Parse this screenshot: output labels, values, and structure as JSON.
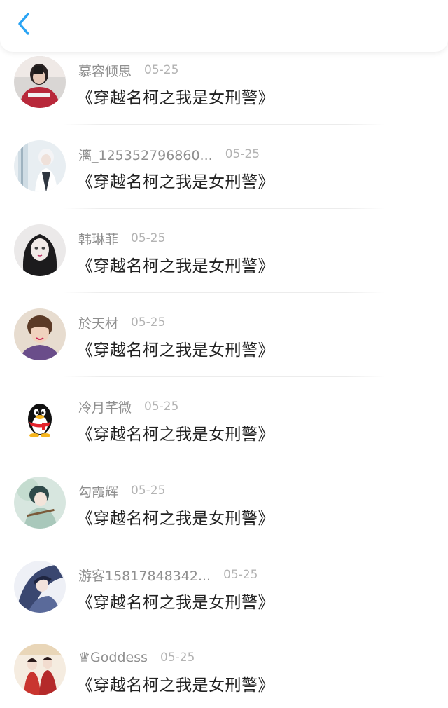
{
  "header": {
    "back_icon": "chevron-left-icon",
    "accent_color": "#2aa4f4"
  },
  "items": [
    {
      "username": "慕容倾思",
      "date": "05-25",
      "title": "《穿越名柯之我是女刑警》",
      "avatar": "girl-selfie-avatar"
    },
    {
      "username": "漓_125352796860...",
      "date": "05-25",
      "title": "《穿越名柯之我是女刑警》",
      "avatar": "anime-boy-avatar"
    },
    {
      "username": "韩琳菲",
      "date": "05-25",
      "title": "《穿越名柯之我是女刑警》",
      "avatar": "anime-girl-avatar"
    },
    {
      "username": "於天材",
      "date": "05-25",
      "title": "《穿越名柯之我是女刑警》",
      "avatar": "boy-photo-avatar"
    },
    {
      "username": "冷月芊微",
      "date": "05-25",
      "title": "《穿越名柯之我是女刑警》",
      "avatar": "qq-penguin-avatar"
    },
    {
      "username": "勾霞辉",
      "date": "05-25",
      "title": "《穿越名柯之我是女刑警》",
      "avatar": "flute-girl-avatar"
    },
    {
      "username": "游客15817848342...",
      "date": "05-25",
      "title": "《穿越名柯之我是女刑警》",
      "avatar": "anime-warrior-avatar"
    },
    {
      "username": "♛Goddess",
      "date": "05-25",
      "title": "《穿越名柯之我是女刑警》",
      "avatar": "ancient-couple-avatar"
    }
  ]
}
